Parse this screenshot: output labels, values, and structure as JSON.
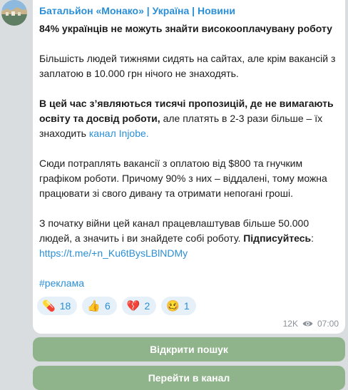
{
  "channel": {
    "name": "Батальйон «Монако» | Україна | Новини"
  },
  "post": {
    "title": "84% українців не можуть знайти високооплачувану роботу",
    "p1": "Більшість людей тижнями сидять на сайтах, але крім вакансій з заплатою в 10.000 грн нічого не знаходять.",
    "p2_bold": "В цей час з’являються тисячі пропозицій, де не вимагають освіту та досвід роботи,",
    "p2_text": " але платять в 2-3 рази більше – їх знаходить ",
    "p2_link": "канал Injobe.",
    "p3": "Сюди потраплять вакансії з оплатою від $800 та гнучким графіком роботи. Причому 90% з них – віддалені, тому можна працювати зі свого дивану та отримати непогані гроші.",
    "p4_text": "З початку війни цей канал працевлаштував більше 50.000 людей, а значить і ви знайдете собі роботу. ",
    "p4_bold": "Підписуйтесь",
    "p4_colon": ":",
    "p4_link": "https://t.me/+n_Ku6tBysLBlNDMy",
    "hashtag": "#реклама"
  },
  "reactions": [
    {
      "emoji": "💊",
      "count": "18"
    },
    {
      "emoji": "👍",
      "count": "6"
    },
    {
      "emoji": "💔",
      "count": "2"
    },
    {
      "emoji": "🥴",
      "count": "1"
    }
  ],
  "meta": {
    "views": "12K",
    "time": "07:00",
    "icon": "eye-icon"
  },
  "buttons": {
    "search": "Відкрити пошук",
    "channel": "Перейти в канал"
  },
  "colors": {
    "accent": "#2a8fd6",
    "button": "#8fb38b",
    "reaction_bg": "#e6f0f8"
  }
}
